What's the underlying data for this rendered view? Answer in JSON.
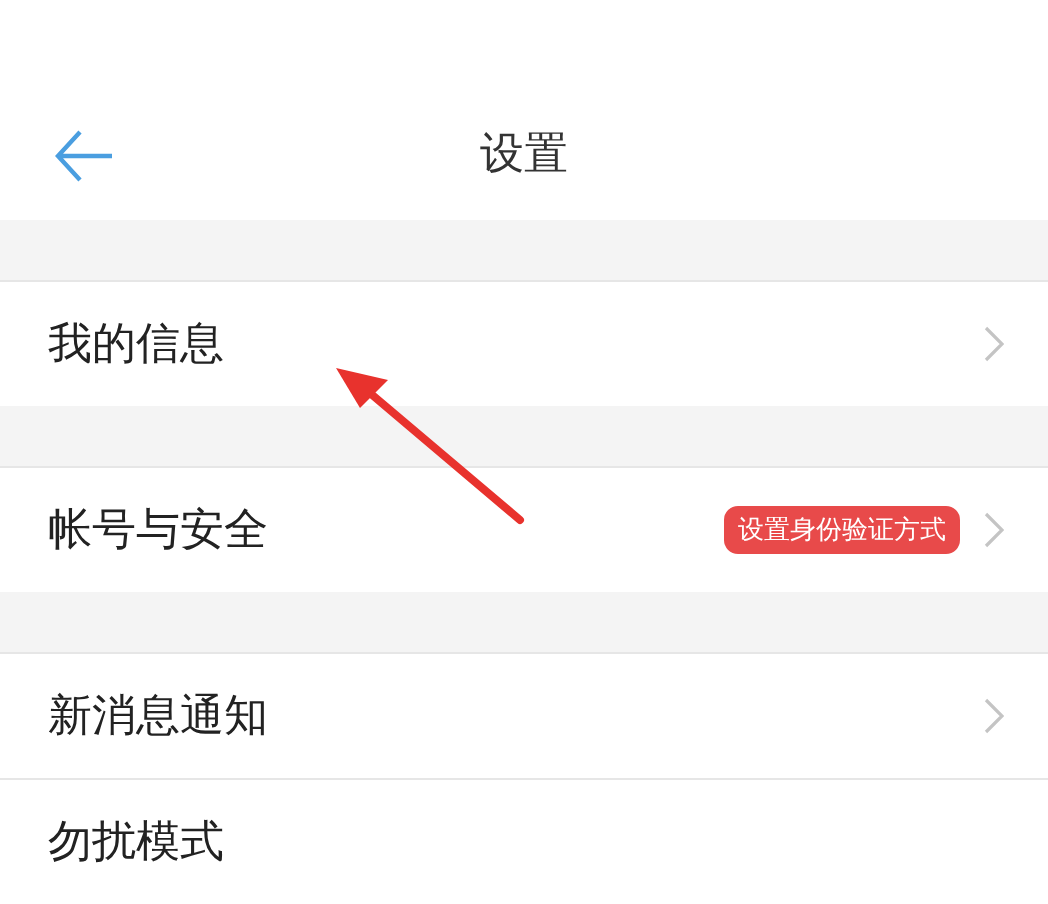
{
  "header": {
    "title": "设置"
  },
  "sections": [
    {
      "rows": [
        {
          "label": "我的信息",
          "chevron": true
        }
      ]
    },
    {
      "rows": [
        {
          "label": "帐号与安全",
          "badge": "设置身份验证方式",
          "chevron": true
        }
      ]
    },
    {
      "rows": [
        {
          "label": "新消息通知",
          "chevron": true
        },
        {
          "label": "勿扰模式",
          "chevron": false
        }
      ]
    }
  ],
  "annotation": {
    "kind": "arrow"
  }
}
